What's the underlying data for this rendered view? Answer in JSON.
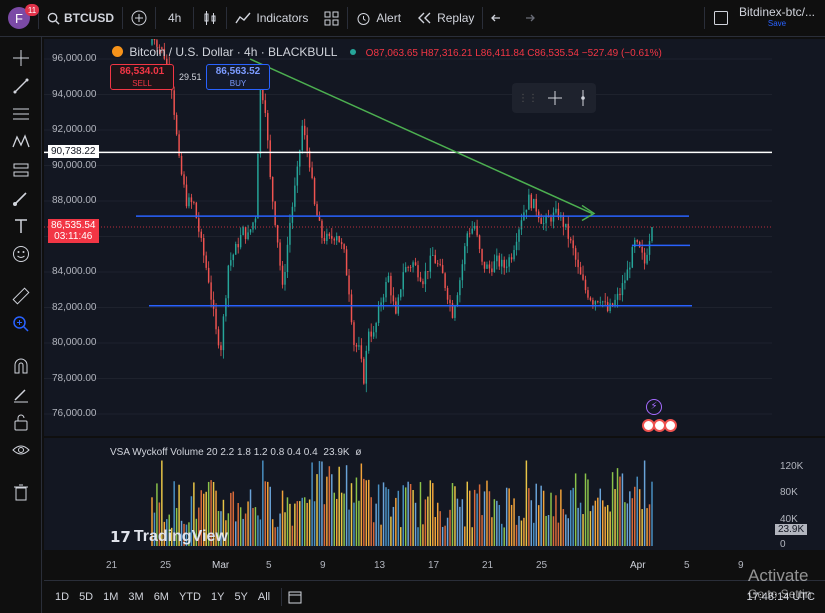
{
  "topbar": {
    "avatar_letter": "F",
    "notifications": "11",
    "symbol": "BTCUSD",
    "interval": "4h",
    "indicators": "Indicators",
    "alert": "Alert",
    "replay": "Replay",
    "layout_name": "Bitdinex-btc/...",
    "save": "Save"
  },
  "legend": {
    "title": "Bitcoin / U.S. Dollar · 4h · BLACKBULL",
    "ohlc": "O87,063.65 H87,316.21 L86,411.84 C86,535.54 −527.49 (−0.61%)"
  },
  "trade": {
    "sell_price": "86,534.01",
    "sell_label": "SELL",
    "spread": "29.51",
    "buy_price": "86,563.52",
    "buy_label": "BUY"
  },
  "price_axis": {
    "ticks": [
      "96,000.00",
      "94,000.00",
      "92,000.00",
      "90,000.00",
      "88,000.00",
      "86,000.00",
      "84,000.00",
      "82,000.00",
      "80,000.00",
      "78,000.00",
      "76,000.00"
    ],
    "line_label": "90,738.22",
    "last_price": "86,535.54",
    "countdown": "03:11:46"
  },
  "volume": {
    "label": "VSA Wyckoff Volume 20 2.2 1.8 1.2 0.8 0.4 0.4",
    "value": "23.9K",
    "extra": "ø",
    "ticks": [
      "120K",
      "80K",
      "40K",
      "0"
    ],
    "current": "23.9K"
  },
  "time_axis": [
    "21",
    "25",
    "Mar",
    "5",
    "9",
    "13",
    "17",
    "21",
    "25",
    "Apr",
    "5",
    "9"
  ],
  "watermark": "TradingView",
  "bottom": {
    "ranges": [
      "1D",
      "5D",
      "1M",
      "3M",
      "6M",
      "YTD",
      "1Y",
      "5Y",
      "All"
    ],
    "clock": "17:48:14 UTC"
  },
  "os": {
    "activate": "Activate",
    "goto": "Go to Settin"
  },
  "colors": {
    "up": "#26a69a",
    "down": "#ef5350",
    "hline": "#2962ff",
    "trend": "#4caf50",
    "sell": "#f23645",
    "buy": "#2962ff"
  }
}
